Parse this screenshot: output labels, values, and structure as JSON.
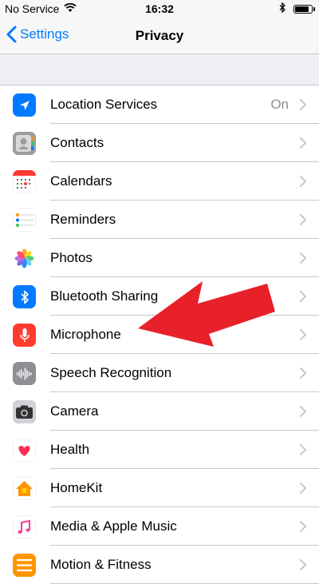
{
  "status_bar": {
    "carrier": "No Service",
    "time": "16:32",
    "battery_level": 0.9
  },
  "nav": {
    "back_label": "Settings",
    "title": "Privacy"
  },
  "rows": [
    {
      "label": "Location Services",
      "value": "On",
      "icon": "location-arrow-icon",
      "color": "#007aff"
    },
    {
      "label": "Contacts",
      "value": "",
      "icon": "contacts-icon",
      "color": "#a7a7a7"
    },
    {
      "label": "Calendars",
      "value": "",
      "icon": "calendar-icon",
      "color": "#ffffff"
    },
    {
      "label": "Reminders",
      "value": "",
      "icon": "reminders-icon",
      "color": "#ffffff"
    },
    {
      "label": "Photos",
      "value": "",
      "icon": "photos-icon",
      "color": "#ffffff"
    },
    {
      "label": "Bluetooth Sharing",
      "value": "",
      "icon": "bluetooth-icon",
      "color": "#007aff"
    },
    {
      "label": "Microphone",
      "value": "",
      "icon": "microphone-icon",
      "color": "#ff3b30"
    },
    {
      "label": "Speech Recognition",
      "value": "",
      "icon": "waveform-icon",
      "color": "#8e8e93"
    },
    {
      "label": "Camera",
      "value": "",
      "icon": "camera-icon",
      "color": "#8e8e93"
    },
    {
      "label": "Health",
      "value": "",
      "icon": "heart-icon",
      "color": "#ffffff"
    },
    {
      "label": "HomeKit",
      "value": "",
      "icon": "home-icon",
      "color": "#ffffff"
    },
    {
      "label": "Media & Apple Music",
      "value": "",
      "icon": "music-note-icon",
      "color": "#ffffff"
    },
    {
      "label": "Motion & Fitness",
      "value": "",
      "icon": "motion-icon",
      "color": "#ff9500"
    }
  ],
  "annotation": {
    "color": "#e8202a"
  }
}
